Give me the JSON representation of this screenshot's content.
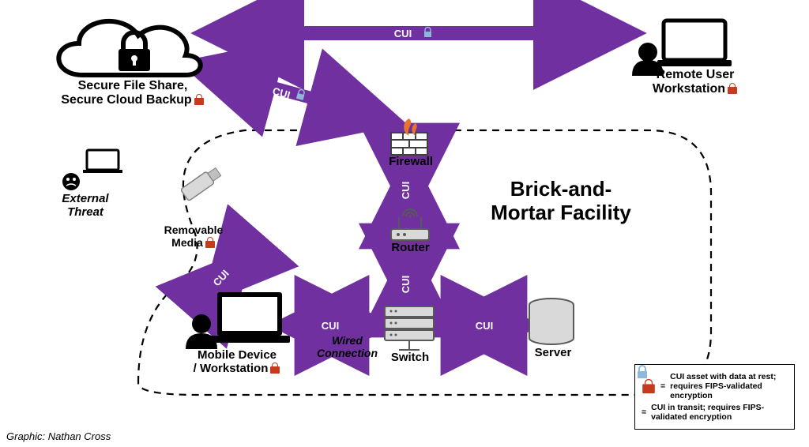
{
  "title": "Brick-and-\nMortar Facility",
  "nodes": {
    "cloud": "Secure File Share,\nSecure Cloud Backup",
    "remote": "Remote User\nWorkstation",
    "threat": "External\nThreat",
    "media": "Removable\nMedia",
    "firewall": "Firewall",
    "router": "Router",
    "switch": "Switch",
    "server": "Server",
    "mobile": "Mobile Device\n/ Workstation",
    "wired": "Wired\nConnection"
  },
  "cui": "CUI",
  "legend": {
    "rest": "CUI asset with data at rest; requires FIPS-validated encryption",
    "transit": "CUI in transit; requires FIPS-validated encryption"
  },
  "credit": "Graphic: Nathan Cross"
}
